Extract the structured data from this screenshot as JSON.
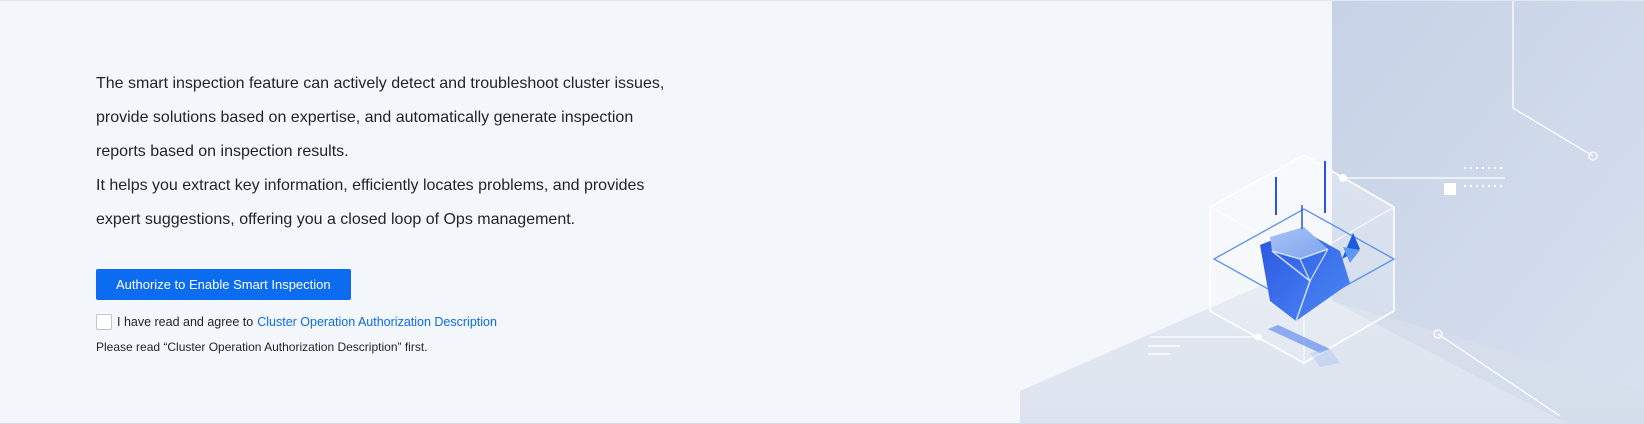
{
  "description": {
    "line1": "The smart inspection feature can actively detect and troubleshoot cluster issues,",
    "line2": "provide solutions based on expertise, and automatically generate inspection",
    "line3": "reports based on inspection results.",
    "line4": "It helps you extract key information, efficiently locates problems, and provides",
    "line5": "expert suggestions, offering you a closed loop of Ops management."
  },
  "actions": {
    "authorize_label": "Authorize to Enable Smart Inspection"
  },
  "agreement": {
    "prefix": "I have read and agree to",
    "link_text": "Cluster Operation Authorization Description",
    "checked": false
  },
  "hint": "Please read “Cluster Operation Authorization Description” first.",
  "colors": {
    "primary": "#0b6cf0",
    "background": "#f3f6fa",
    "text": "#1f2329"
  },
  "illustration": {
    "icon": "diamond-cube-illustration"
  }
}
